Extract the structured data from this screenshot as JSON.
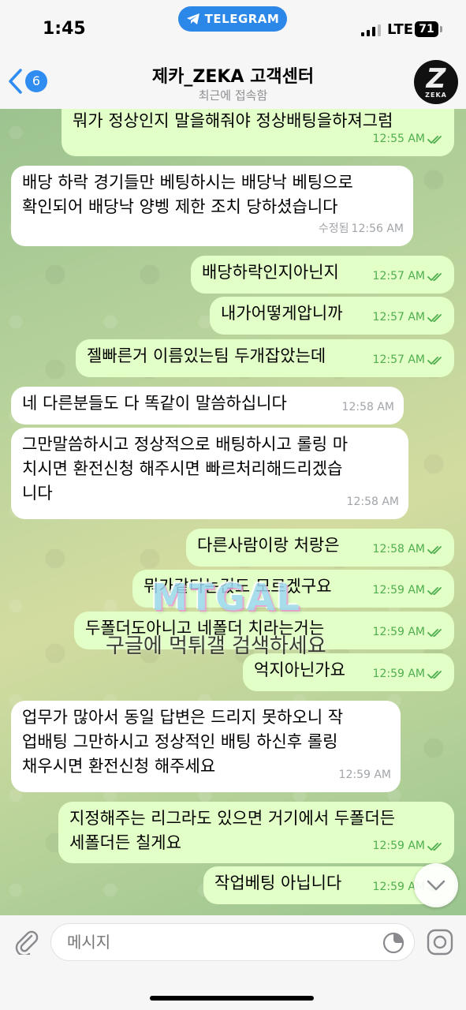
{
  "status_bar": {
    "time": "1:45",
    "app_pill": "TELEGRAM",
    "network": "LTE",
    "battery": "71"
  },
  "header": {
    "back_count": "6",
    "title": "제카_ZEKA 고객센터",
    "subtitle": "최근에 접속함",
    "avatar_letter": "Z",
    "avatar_label": "ZEKA"
  },
  "messages": [
    {
      "dir": "out",
      "text": "뭐가 정상인지 말을해줘야 정상배팅을하져그럼",
      "time": "12:55 AM"
    },
    {
      "dir": "in",
      "text": "배당 하락 경기들만 베팅하시는 배당낙 베팅으로\n확인되어 배당낙 양벵 제한 조치 당하셨습니다",
      "edited": "수정됨",
      "time": "12:56 AM"
    },
    {
      "dir": "out",
      "text": "배당하락인지아닌지",
      "time": "12:57 AM"
    },
    {
      "dir": "out",
      "text": "내가어떻게압니까",
      "time": "12:57 AM"
    },
    {
      "dir": "out",
      "text": "젤빠른거 이름있는팀 두개잡았는데",
      "time": "12:57 AM"
    },
    {
      "dir": "in",
      "text": "네 다른분들도 다 똑같이 말씀하십니다",
      "time": "12:58 AM"
    },
    {
      "dir": "in",
      "text": "그만말씀하시고 정상적으로 배팅하시고 롤링 마\n치시면 환전신청 해주시면 빠르처리해드리겠습\n니다",
      "time": "12:58 AM"
    },
    {
      "dir": "out",
      "text": "다른사람이랑 처랑은",
      "time": "12:58 AM"
    },
    {
      "dir": "out",
      "text": "뭐가같다는걵도 모르겠구요",
      "time": "12:59 AM"
    },
    {
      "dir": "out",
      "text": "두폴더도아니고 네폴더 치라는거는",
      "time": "12:59 AM"
    },
    {
      "dir": "out",
      "text": "억지아닌가요",
      "time": "12:59 AM"
    },
    {
      "dir": "in",
      "text": "업무가 많아서 동일 답변은 드리지 못하오니 작\n업배팅 그만하시고 정상적인 배팅 하신후 롤링\n채우시면 환전신청 해주세요",
      "time": "12:59 AM"
    },
    {
      "dir": "out",
      "text": "지정해주는 리그라도 있으면 거기에서 두폴더든\n세폴더든 칠게요",
      "time": "12:59 AM"
    },
    {
      "dir": "out",
      "text": "작업베팅 아닙니다",
      "time": "12:59 AM"
    }
  ],
  "watermark": {
    "logo": "MTGAL",
    "text": "구글에 먹튀갤 검색하세요"
  },
  "input": {
    "placeholder": "메시지"
  },
  "colors": {
    "outgoing_bubble": "#e2ffc7",
    "incoming_bubble": "#ffffff",
    "accent": "#2f8cf0",
    "outgoing_time": "#4fae4e"
  }
}
